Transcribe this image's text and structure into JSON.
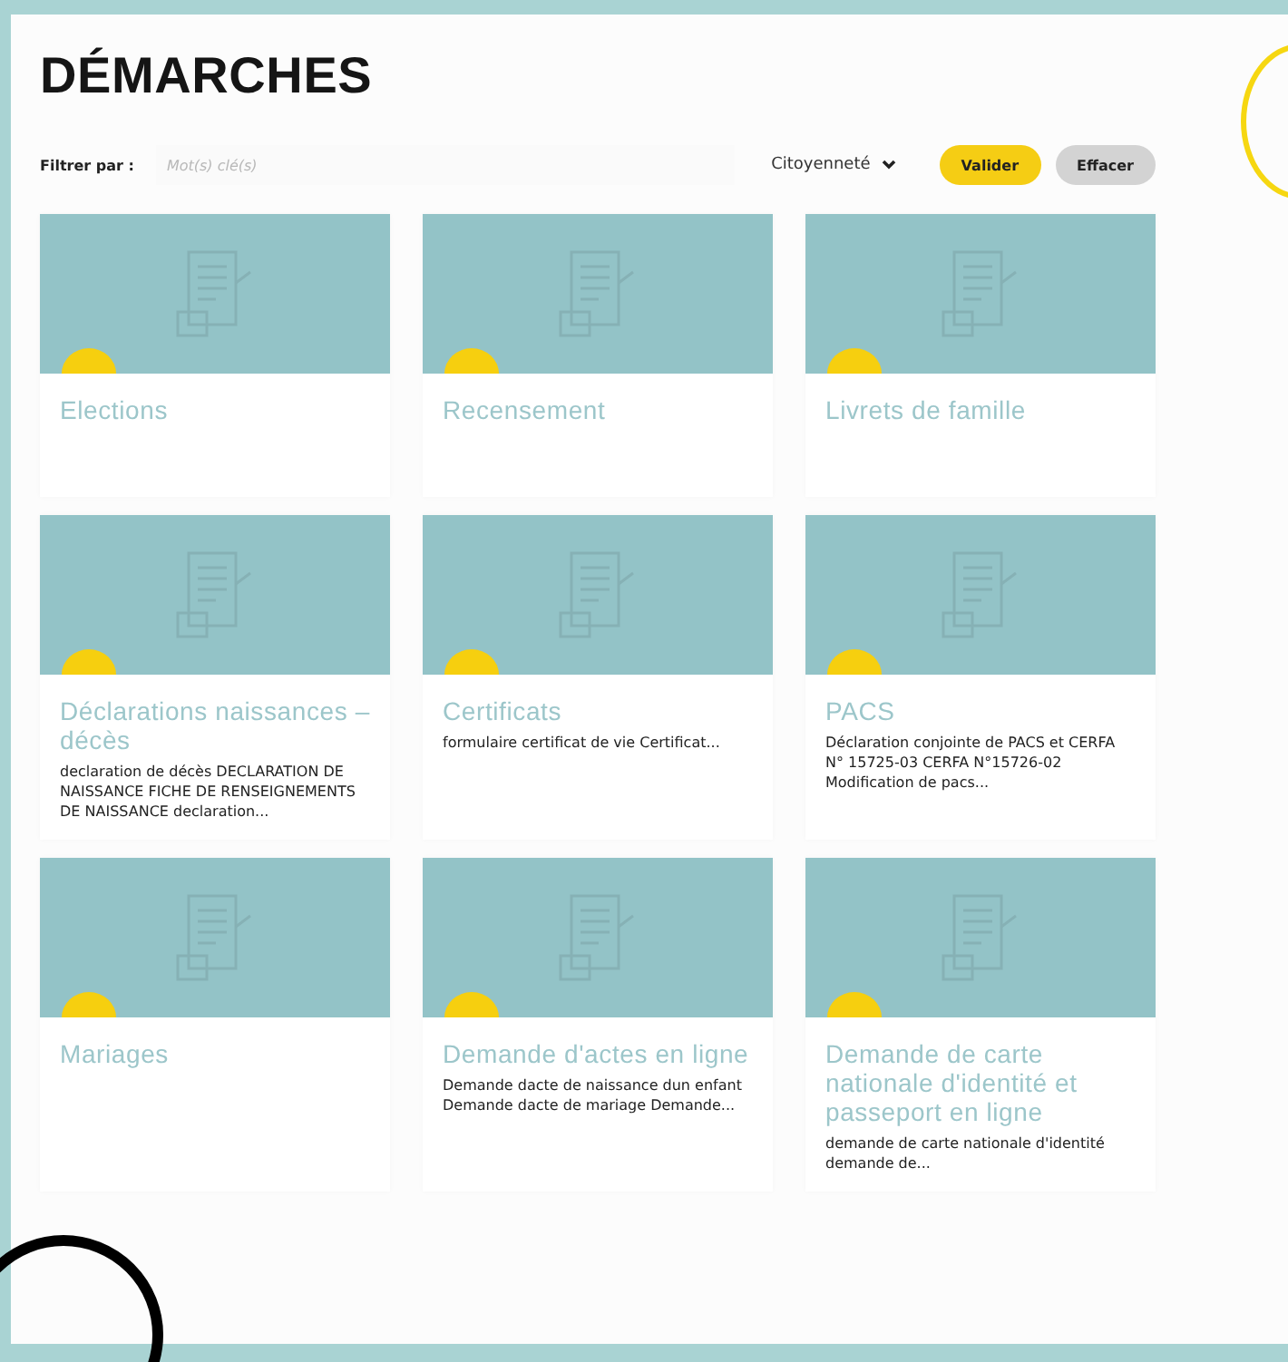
{
  "page": {
    "title": "DÉMARCHES"
  },
  "filter": {
    "label": "Filtrer par :",
    "placeholder": "Mot(s) clé(s)",
    "category": "Citoyenneté",
    "buttons": [
      {
        "kind": "primary",
        "label": "Valider"
      },
      {
        "kind": "secondary",
        "label": "Effacer"
      }
    ]
  },
  "cards": [
    {
      "title": "Elections"
    },
    {
      "title": "Recensement"
    },
    {
      "title": "Livrets de famille"
    },
    {
      "title": "Déclarations naissances – décès",
      "description": "declaration de décès DECLARATION DE NAISSANCE FICHE DE RENSEIGNEMENTS DE NAISSANCE declaration..."
    },
    {
      "title": "Certificats",
      "description": "formulaire certificat de vie Certificat..."
    },
    {
      "title": "PACS",
      "description": "Déclaration conjointe de PACS et CERFA N° 15725-03 CERFA N°15726-02 Modification de pacs..."
    },
    {
      "title": "Mariages"
    },
    {
      "title": "Demande d'actes en ligne",
      "description": "Demande dacte de naissance dun enfant Demande dacte de mariage Demande..."
    },
    {
      "title": "Demande de carte nationale d'identité et passeport en ligne",
      "description": "demande de carte nationale d'identité demande de..."
    }
  ]
}
